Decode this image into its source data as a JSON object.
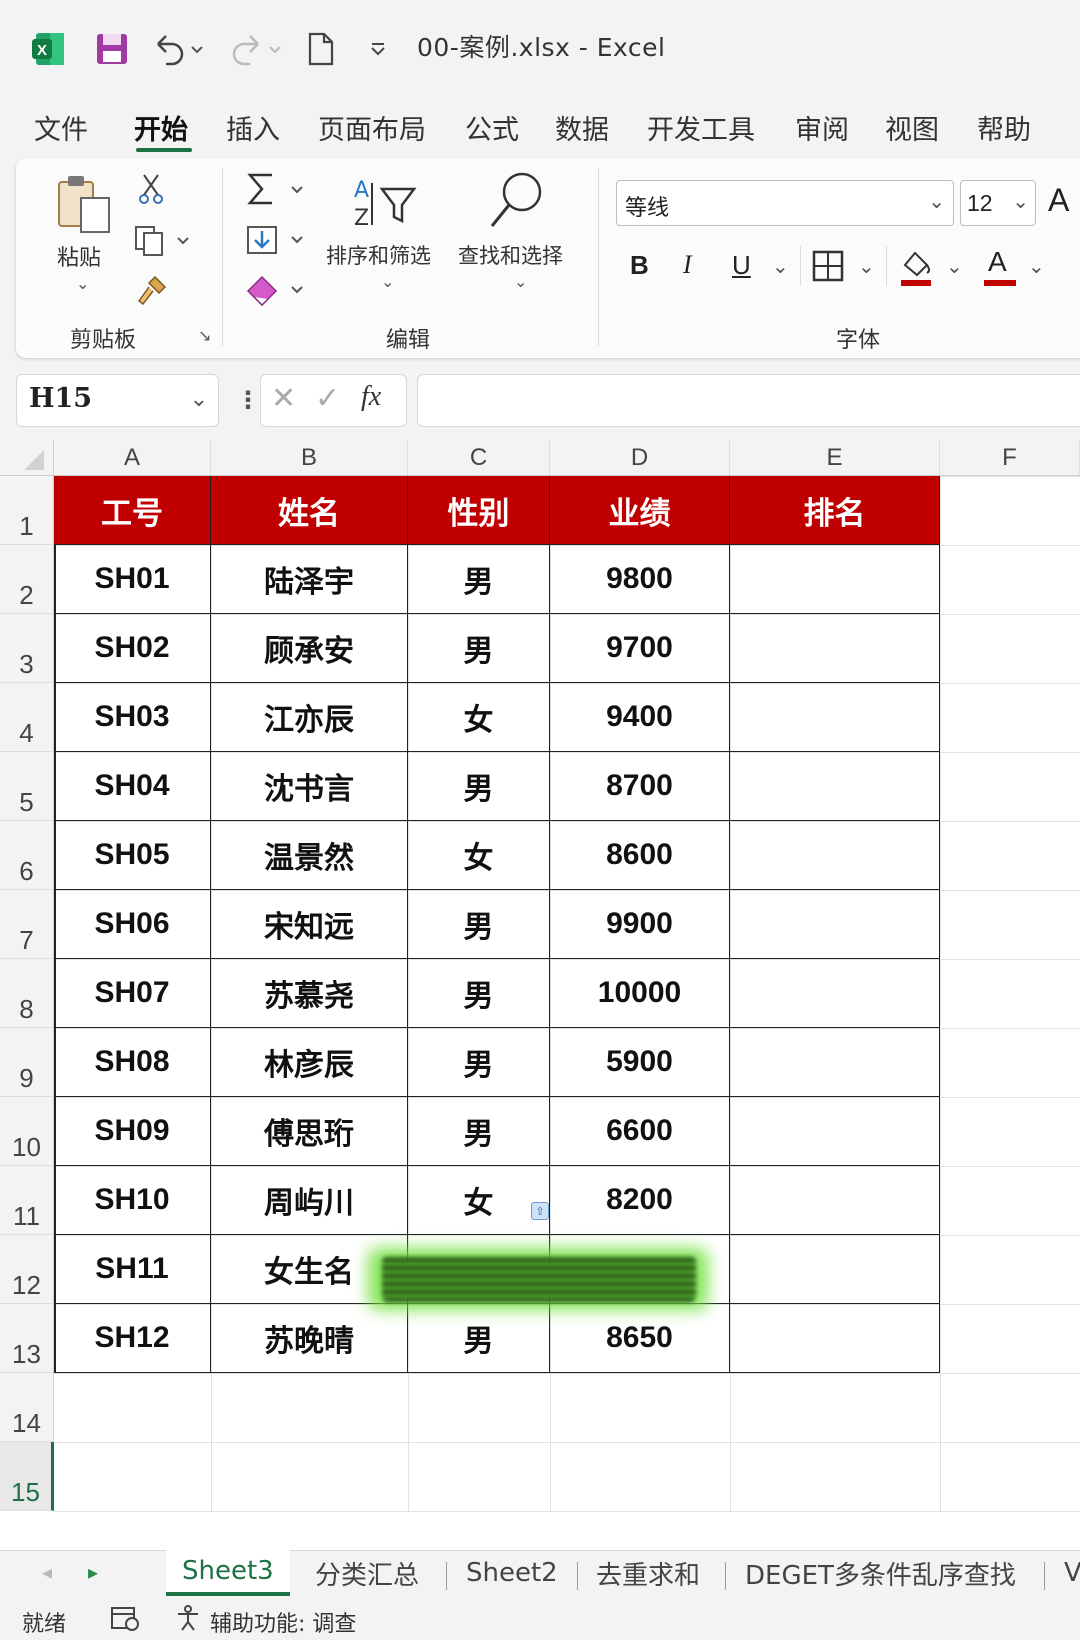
{
  "app": {
    "title": "00-案例.xlsx  -  Excel"
  },
  "menu": {
    "items": [
      "文件",
      "开始",
      "插入",
      "页面布局",
      "公式",
      "数据",
      "开发工具",
      "审阅",
      "视图",
      "帮助"
    ],
    "active": "开始"
  },
  "ribbon": {
    "clipboard": {
      "group_label": "剪贴板",
      "paste_label": "粘贴"
    },
    "editing": {
      "group_label": "编辑",
      "sort_filter_label": "排序和筛选",
      "find_select_label": "查找和选择"
    },
    "font": {
      "group_label": "字体",
      "font_name": "等线",
      "font_size": "12",
      "bold": "B",
      "italic": "I",
      "underline": "U",
      "font_color_glyph": "A",
      "grow_glyph": "A"
    }
  },
  "formula_bar": {
    "name_box": "H15",
    "fx": "fx",
    "formula": ""
  },
  "sheet": {
    "columns": [
      "A",
      "B",
      "C",
      "D",
      "E",
      "F"
    ],
    "rows": [
      "1",
      "2",
      "3",
      "4",
      "5",
      "6",
      "7",
      "8",
      "9",
      "10",
      "11",
      "12",
      "13",
      "14",
      "15"
    ],
    "selected_row": "15",
    "header": [
      "工号",
      "姓名",
      "性别",
      "业绩",
      "排名"
    ],
    "data": [
      [
        "SH01",
        "陆泽宇",
        "男",
        "9800",
        ""
      ],
      [
        "SH02",
        "顾承安",
        "男",
        "9700",
        ""
      ],
      [
        "SH03",
        "江亦辰",
        "女",
        "9400",
        ""
      ],
      [
        "SH04",
        "沈书言",
        "男",
        "8700",
        ""
      ],
      [
        "SH05",
        "温景然",
        "女",
        "8600",
        ""
      ],
      [
        "SH06",
        "宋知远",
        "男",
        "9900",
        ""
      ],
      [
        "SH07",
        "苏慕尧",
        "男",
        "10000",
        ""
      ],
      [
        "SH08",
        "林彦辰",
        "男",
        "5900",
        ""
      ],
      [
        "SH09",
        "傅思珩",
        "男",
        "6600",
        ""
      ],
      [
        "SH10",
        "周屿川",
        "女",
        "8200",
        ""
      ],
      [
        "SH11",
        "女生名",
        "",
        "",
        ""
      ],
      [
        "SH12",
        "苏晚晴",
        "男",
        "8650",
        ""
      ]
    ],
    "header_bg": "#c00000"
  },
  "sheet_tabs": {
    "items": [
      "Sheet3",
      "分类汇总",
      "Sheet2",
      "去重求和",
      "DEGET多条件乱序查找",
      "V"
    ],
    "active": "Sheet3"
  },
  "status_bar": {
    "ready": "就绪",
    "accessibility": "辅助功能: 调查"
  },
  "colors": {
    "accent": "#1e7145",
    "header_red": "#c00000",
    "highlight_green": "#6fe03a"
  }
}
